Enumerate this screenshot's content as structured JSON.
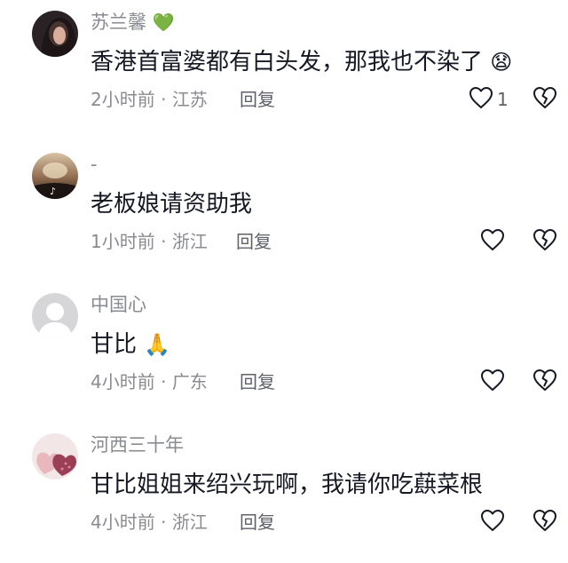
{
  "comments": [
    {
      "username": "苏兰馨",
      "username_emoji": "💚",
      "text": "香港首富婆都有白头发，那我也不染了",
      "text_emoji": "😧",
      "time": "2小时前",
      "separator": " · ",
      "location": "江苏",
      "reply_label": "回复",
      "like_count": "1",
      "avatar": "dark-portrait"
    },
    {
      "username": "-",
      "text": "老板娘请资助我",
      "time": "1小时前",
      "separator": " · ",
      "location": "浙江",
      "reply_label": "回复",
      "avatar": "sunset-tiktok"
    },
    {
      "username": "中国心",
      "text": "甘比",
      "text_emoji": "🙏",
      "time": "4小时前",
      "separator": " · ",
      "location": "广东",
      "reply_label": "回复",
      "avatar": "default-gray"
    },
    {
      "username": "河西三十年",
      "text": "甘比姐姐来绍兴玩啊，我请你吃蕻菜根",
      "time": "4小时前",
      "separator": " · ",
      "location": "浙江",
      "reply_label": "回复",
      "avatar": "pink-hearts"
    }
  ],
  "icons": {
    "like": "heart-outline-icon",
    "dislike": "broken-heart-icon"
  },
  "colors": {
    "text": "#161823",
    "meta": "#8a8b91",
    "username_emoji": "#2ec25a"
  }
}
